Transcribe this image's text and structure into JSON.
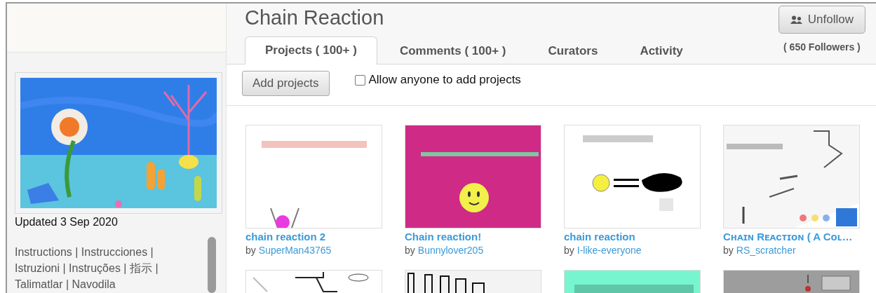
{
  "sidebar": {
    "thumbnail": {
      "kind": "picture"
    },
    "updated": "Updated 3 Sep 2020",
    "description": "Instructions | Instrucciones | Istruzioni | Instruções | 指示 | Talimatlar | Navodila"
  },
  "studio": {
    "title": "Chain Reaction",
    "follow_button": "Unfollow",
    "followers": "( 650 Followers )"
  },
  "tabs": [
    {
      "label": "Projects ( 100+ )",
      "selected": true
    },
    {
      "label": "Comments ( 100+ )",
      "selected": false
    },
    {
      "label": "Curators",
      "selected": false
    },
    {
      "label": "Activity",
      "selected": false
    }
  ],
  "toolbar": {
    "add_button": "Add projects",
    "allow_anyone": {
      "label": "Allow anyone to add projects",
      "checked": false
    }
  },
  "projects": [
    {
      "thumbnail": {
        "kind": "picture"
      },
      "title": "chain reaction 2",
      "by": "by",
      "author": "SuperMan43765"
    },
    {
      "thumbnail": {
        "kind": "picture"
      },
      "title": "Chain reaction!",
      "by": "by",
      "author": "Bunnylover205"
    },
    {
      "thumbnail": {
        "kind": "picture"
      },
      "title": "chain reaction",
      "by": "by",
      "author": "I-like-everyone"
    },
    {
      "thumbnail": {
        "kind": "picture"
      },
      "title": "Cʜᴀɪɴ Rᴇᴀᴄᴛɪᴏɴ ( A Cᴏʟ…",
      "by": "by",
      "author": "RS_scratcher"
    },
    {
      "thumbnail": {
        "kind": "picture"
      }
    },
    {
      "thumbnail": {
        "kind": "picture"
      }
    },
    {
      "thumbnail": {
        "kind": "picture"
      }
    },
    {
      "thumbnail": {
        "kind": "picture"
      }
    }
  ]
}
